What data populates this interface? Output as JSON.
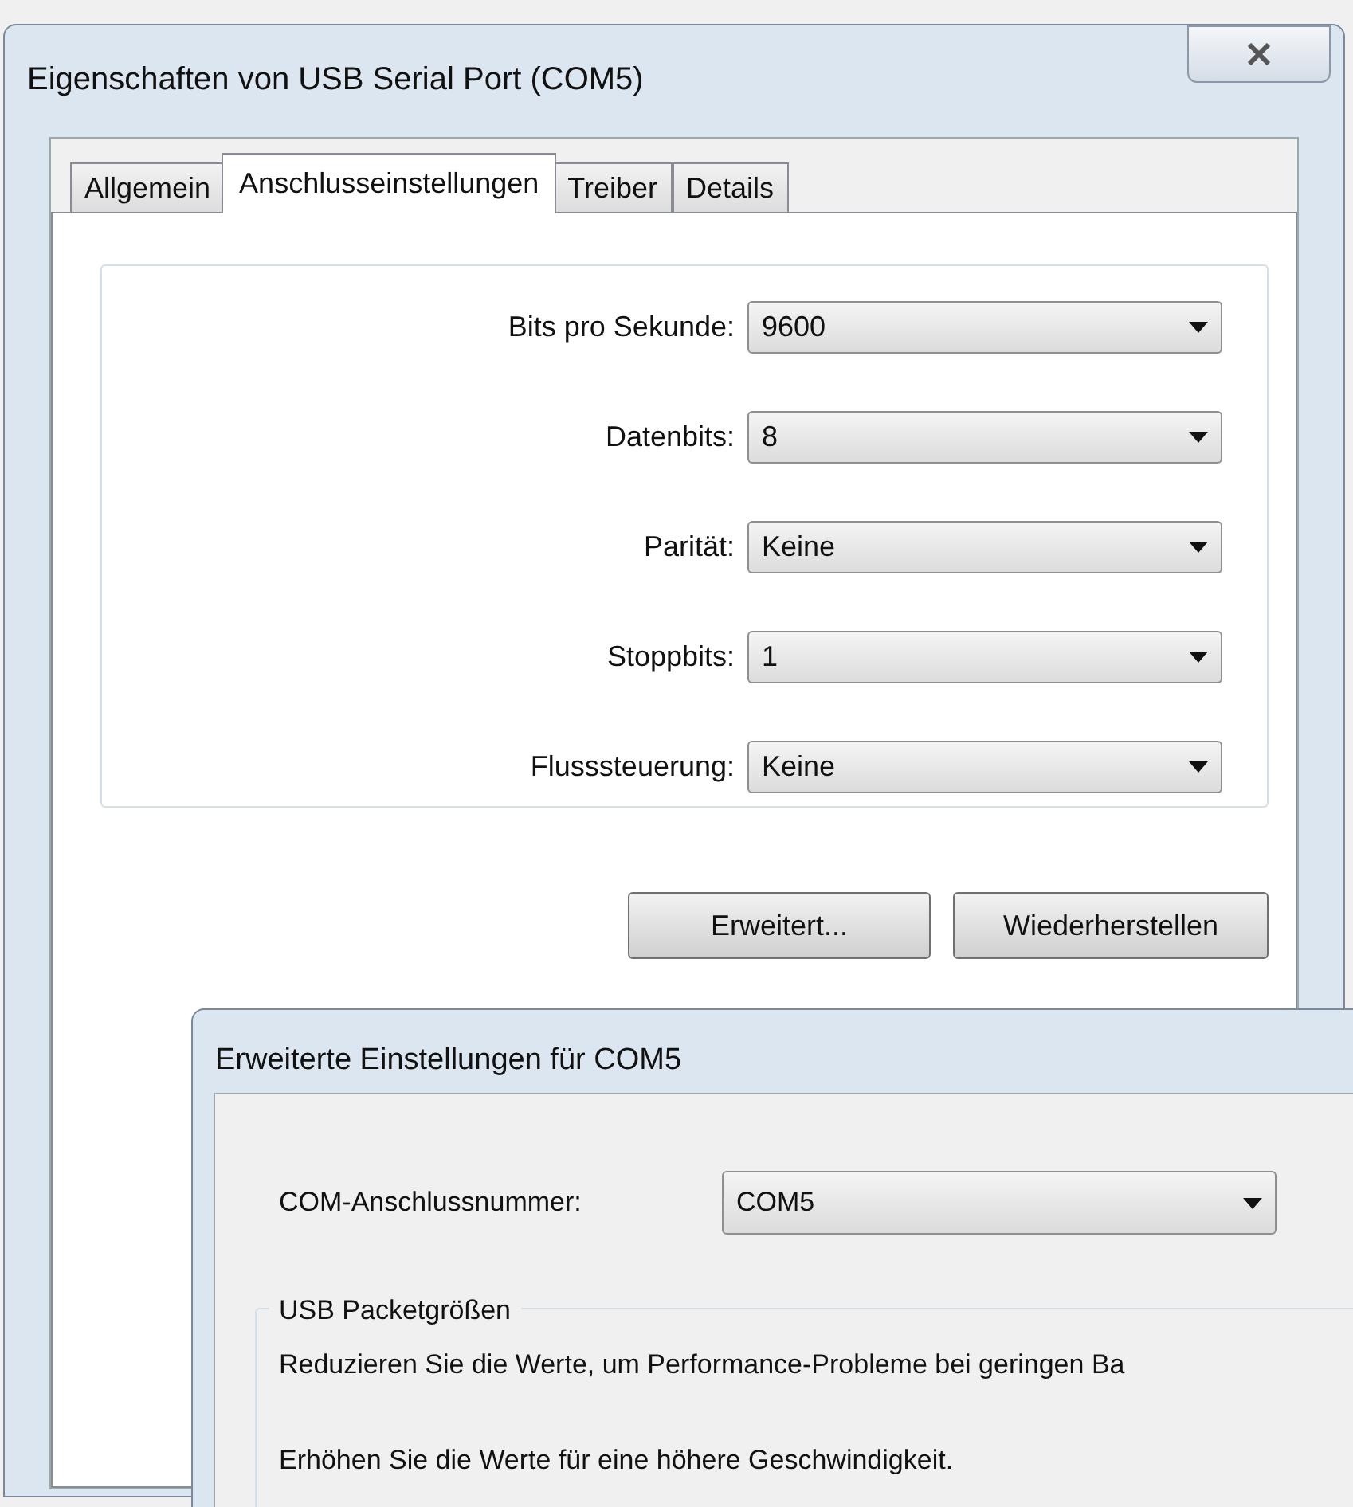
{
  "window": {
    "title": "Eigenschaften von USB Serial Port (COM5)"
  },
  "tabs": [
    {
      "label": "Allgemein",
      "selected": false
    },
    {
      "label": "Anschlusseinstellungen",
      "selected": true
    },
    {
      "label": "Treiber",
      "selected": false
    },
    {
      "label": "Details",
      "selected": false
    }
  ],
  "settings": [
    {
      "label": "Bits pro Sekunde:",
      "value": "9600"
    },
    {
      "label": "Datenbits:",
      "value": "8"
    },
    {
      "label": "Parität:",
      "value": "Keine"
    },
    {
      "label": "Stoppbits:",
      "value": "1"
    },
    {
      "label": "Flusssteuerung:",
      "value": "Keine"
    }
  ],
  "buttons": [
    "Erweitert...",
    "Wiederherstellen"
  ],
  "advanced_dialog": {
    "title": "Erweiterte Einstellungen für COM5",
    "port": {
      "label": "COM-Anschlussnummer:",
      "value": "COM5"
    },
    "group": {
      "title": "USB Packetgrößen",
      "lines": [
        "Reduzieren Sie die Werte, um Performance-Probleme bei geringen Ba",
        "Erhöhen Sie die Werte für eine höhere Geschwindigkeit."
      ]
    }
  }
}
